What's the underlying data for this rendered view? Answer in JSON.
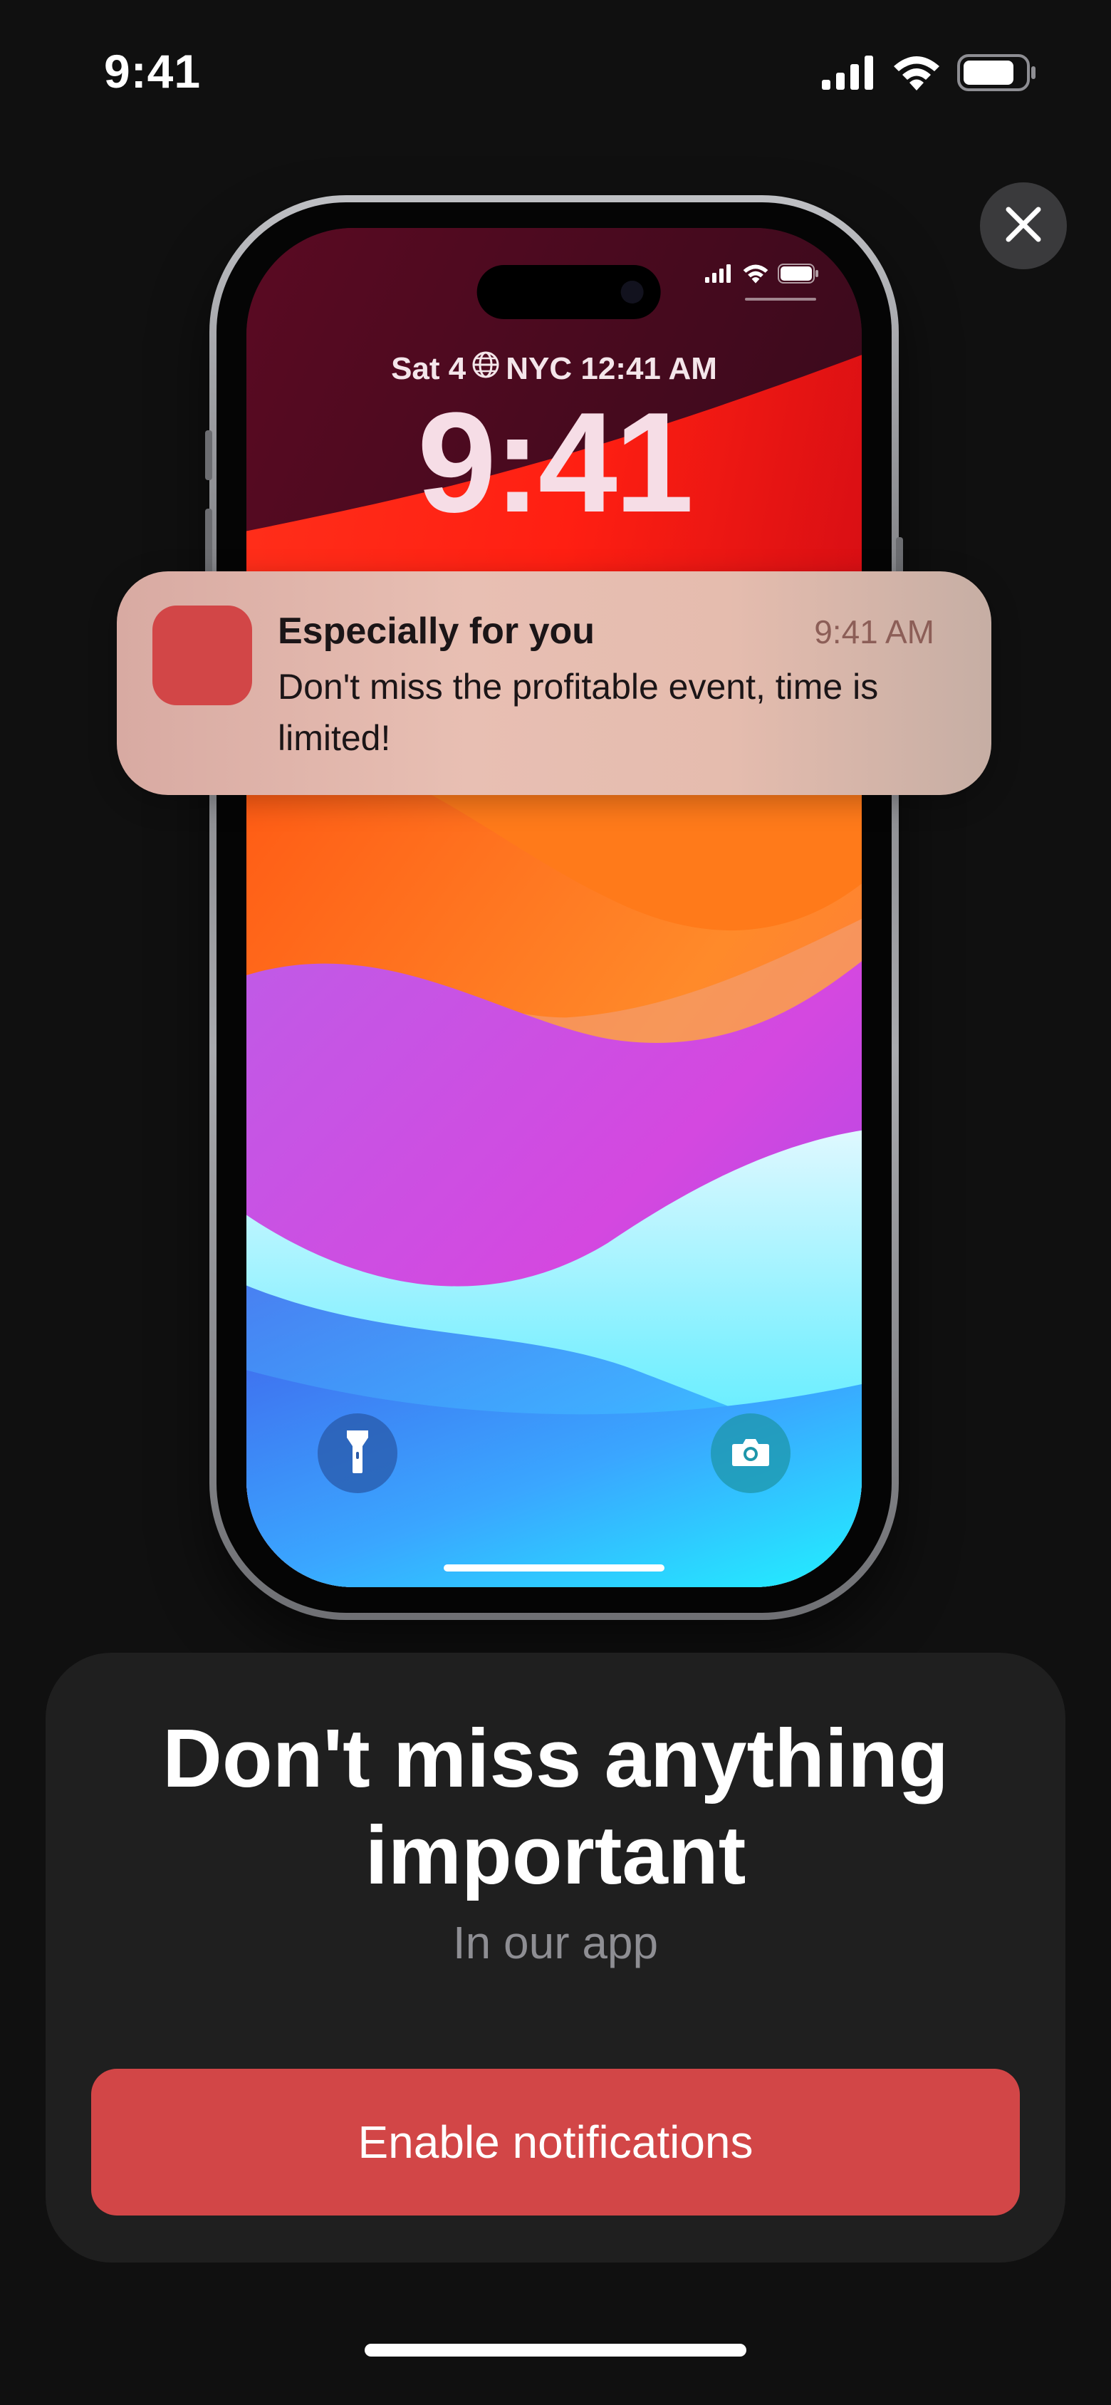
{
  "status_bar": {
    "time": "9:41",
    "icons": [
      "signal-icon",
      "wifi-icon",
      "battery-icon"
    ]
  },
  "close_button": {
    "icon": "close-icon"
  },
  "lock_screen": {
    "date_label": "Sat 4",
    "location_time": "NYC 12:41 AM",
    "time": "9:41",
    "left_button_icon": "flashlight-icon",
    "right_button_icon": "camera-icon"
  },
  "notification": {
    "title": "Especially for you",
    "time": "9:41 AM",
    "body": "Don't miss the profitable event, time is limited!",
    "icon_color": "#d24647"
  },
  "card": {
    "title": "Don't miss anything important",
    "subtitle": "In our app",
    "button_label": "Enable notifications",
    "accent_color": "#d24647"
  }
}
